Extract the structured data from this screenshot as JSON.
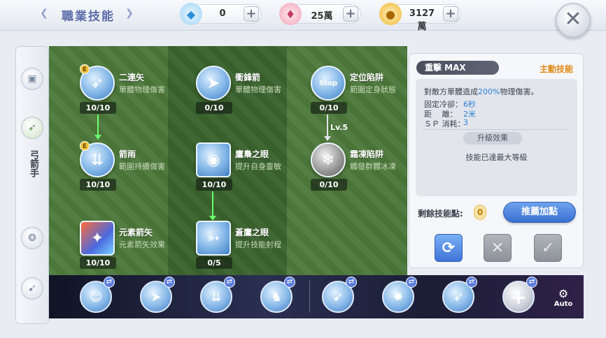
{
  "header": {
    "title": "職業技能",
    "currencies": [
      {
        "icon": "diamond-icon",
        "value": "0"
      },
      {
        "icon": "crystal-icon",
        "value": "25萬"
      },
      {
        "icon": "zeny-coin-icon",
        "value": "3127萬"
      }
    ],
    "plus": "+",
    "close": "✕"
  },
  "sidebar": {
    "class_label": "弓箭手"
  },
  "tree": {
    "skills": [
      {
        "name": "二連矢",
        "desc": "單體物理傷害",
        "level": "10/10",
        "badge": "E"
      },
      {
        "name": "衝鋒箭",
        "desc": "單體物理傷害",
        "level": "0/10"
      },
      {
        "name": "定位陷阱",
        "desc": "範圍定身狀態",
        "level": "0/10",
        "icon_text": "Stop"
      },
      {
        "name": "箭雨",
        "desc": "範圍持續傷害",
        "level": "10/10",
        "badge": "E"
      },
      {
        "name": "鷹梟之眼",
        "desc": "提升自身靈敏",
        "level": "10/10"
      },
      {
        "name": "霜凍陷阱",
        "desc": "觸發群體冰凍",
        "level": "0/10"
      },
      {
        "name": "元素箭矢",
        "desc": "元素箭矢效果",
        "level": "10/10"
      },
      {
        "name": "蒼鷹之眼",
        "desc": "提升技能射程",
        "level": "0/5"
      }
    ],
    "requirement_label": "Lv.5"
  },
  "detail": {
    "skill_name": "重擊 MAX",
    "skill_type": "主動技能",
    "desc_prefix": "對敵方單體造成",
    "desc_percent": "200%",
    "desc_suffix": "物理傷害。",
    "stats": [
      {
        "label": "固定冷卻：",
        "value": "6秒"
      },
      {
        "label": "距　 離：",
        "value": "2米"
      },
      {
        "label": "ＳＰ 消耗：",
        "value": "3"
      }
    ],
    "upgrade_label": "升級效果",
    "max_text": "技能已達最大等級",
    "remaining_label": "剩餘技能點:",
    "remaining_value": "0",
    "recommend_button": "推薦加點"
  },
  "bottom": {
    "auto_label": "Auto"
  },
  "colors": {
    "accent_blue": "#3a6fd0",
    "skill_type_orange": "#e08a18",
    "highlight_blue": "#2f7fd6",
    "tree_green": "#4a7638"
  }
}
